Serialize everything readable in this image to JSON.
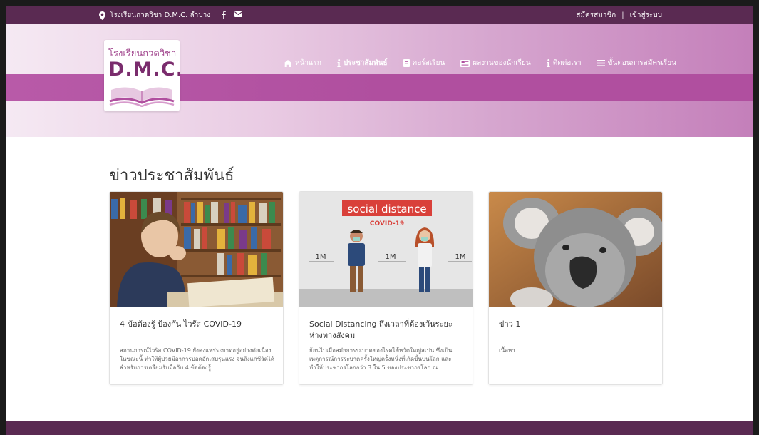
{
  "topbar": {
    "location": "โรงเรียนกวดวิชา D.M.C. ลำปาง",
    "register": "สมัครสมาชิก",
    "divider": "|",
    "login": "เข้าสู่ระบบ"
  },
  "logo": {
    "line1": "โรงเรียนกวดวิชา",
    "line2": "D.M.C."
  },
  "nav": {
    "items": [
      {
        "label": "หน้าแรก",
        "icon": "home-icon"
      },
      {
        "label": "ประชาสัมพันธ์",
        "icon": "info-icon"
      },
      {
        "label": "คอร์สเรียน",
        "icon": "book-icon"
      },
      {
        "label": "ผลงานของนักเรียน",
        "icon": "newspaper-icon"
      },
      {
        "label": "ติดต่อเรา",
        "icon": "info-icon"
      },
      {
        "label": "ขั้นตอนการสมัครเรียน",
        "icon": "list-icon"
      }
    ]
  },
  "section": {
    "title": "ข่าวประชาสัมพันธ์"
  },
  "cards": [
    {
      "title": "4 ข้อต้องรู้ ป้องกัน ไวรัส COVID-19",
      "excerpt": "สถานการณ์ไวรัส COVID-19 ยังคงแพร่ระบาดอยู่อย่างต่อเนื่องในขณะนี้ ทำให้ผู้ป่วยมีอาการปอดอักเสบรุนแรง จนถึงแก่ชีวิตได้ สำหรับการเตรียมรับมือกับ 4 ข้อต้องรู้..."
    },
    {
      "title": "Social Distancing ถึงเวลาที่ต้องเว้นระยะห่างทางสังคม",
      "excerpt": "ย้อนไปเมื่อสมัยการระบาดของไรคไข้หวัดใหญ่สเปน ซึ่งเป็นเหตุการณ์การระบาดครั้งใหญ่ครั้งหนึ่งที่เกิดขึ้นบนโลก และทำให้ประชากรโลกกว่า 3 ใน 5 ของประชากรโลก ณ...",
      "image_text": {
        "banner": "social distance",
        "sub": "COVID-19",
        "dist": "1M"
      }
    },
    {
      "title": "ข่าว 1",
      "excerpt": "เนื้อหา ..."
    }
  ],
  "colors": {
    "topbar": "#5a2a52",
    "navband": "#b04f9f",
    "accent": "#a2488f"
  }
}
